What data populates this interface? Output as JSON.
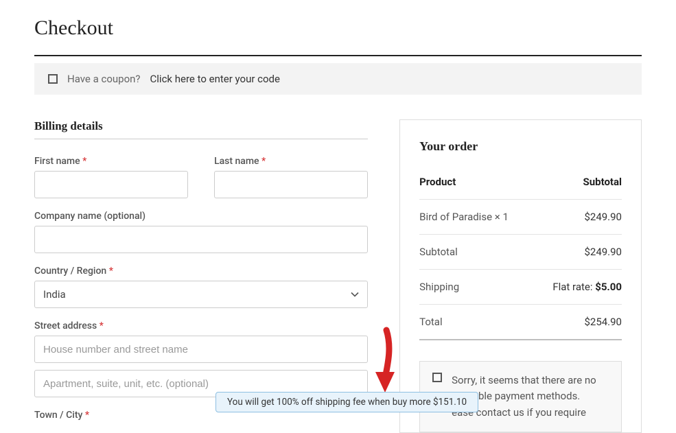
{
  "page": {
    "title": "Checkout"
  },
  "coupon": {
    "prompt": "Have a coupon?",
    "link": "Click here to enter your code"
  },
  "billing": {
    "heading": "Billing details",
    "first_name_label": "First name",
    "last_name_label": "Last name",
    "company_label": "Company name (optional)",
    "country_label": "Country / Region",
    "country_value": "India",
    "street_label": "Street address",
    "street_placeholder1": "House number and street name",
    "street_placeholder2": "Apartment, suite, unit, etc. (optional)",
    "town_label": "Town / City",
    "required_mark": "*"
  },
  "order": {
    "heading": "Your order",
    "col_product": "Product",
    "col_subtotal": "Subtotal",
    "item_name": "Bird of Paradise  × 1",
    "item_price": "$249.90",
    "subtotal_label": "Subtotal",
    "subtotal_value": "$249.90",
    "shipping_label": "Shipping",
    "shipping_rate_prefix": "Flat rate:",
    "shipping_rate_value": "$5.00",
    "total_label": "Total",
    "total_value": "$254.90"
  },
  "payment_notice": {
    "line1": "Sorry, it seems that there are no",
    "line2": "available payment methods.",
    "line3": "ease contact us if you require"
  },
  "tooltip": {
    "text": "You will get 100% off shipping fee when buy more $151.10"
  }
}
